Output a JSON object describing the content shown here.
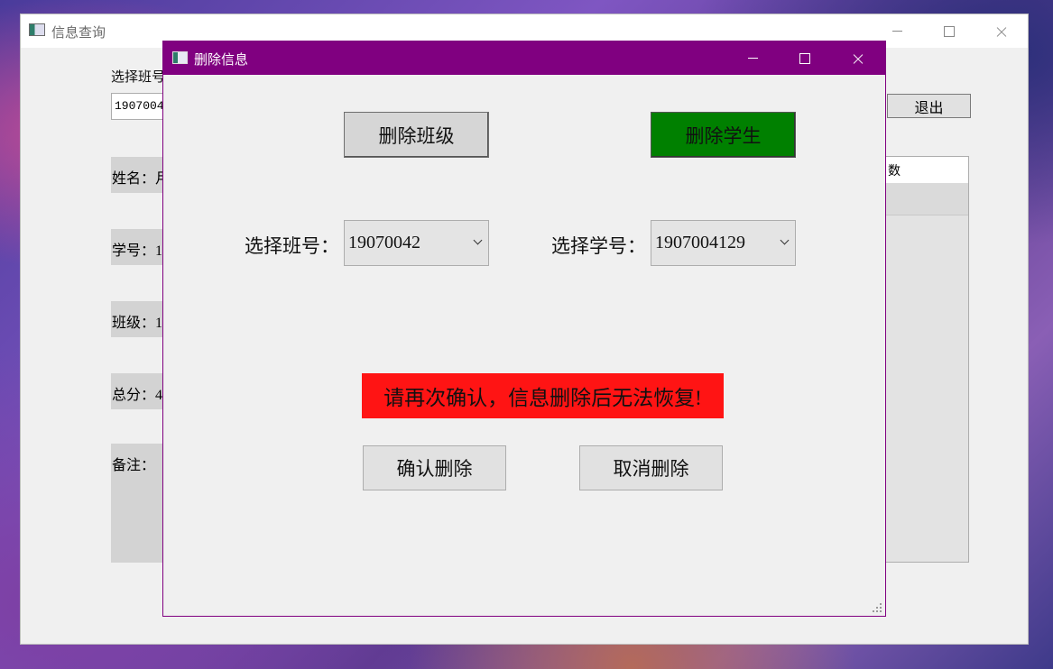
{
  "main_window": {
    "title": "信息查询",
    "class_label": "选择班号",
    "class_value": "1907004",
    "name_label": "姓名：",
    "name_value_partial": "月",
    "id_label": "学号：",
    "id_value_partial": "1",
    "class_field_label": "班级：",
    "class_field_value_partial": "1",
    "total_label": "总分：",
    "total_value_partial": "4",
    "note_label": "备注：",
    "exit_label": "退出",
    "table_header_partial": "数"
  },
  "dialog": {
    "title": "删除信息",
    "delete_class_label": "删除班级",
    "delete_student_label": "删除学生",
    "class_select_label": "选择班号：",
    "class_select_value": "19070042",
    "student_select_label": "选择学号：",
    "student_select_value": "1907004129",
    "warning_text": "请再次确认，信息删除后无法恢复!",
    "confirm_label": "确认删除",
    "cancel_label": "取消删除"
  },
  "colors": {
    "dialog_titlebar": "#800080",
    "delete_student_bg": "#008000",
    "warning_bg": "#ff1414"
  }
}
